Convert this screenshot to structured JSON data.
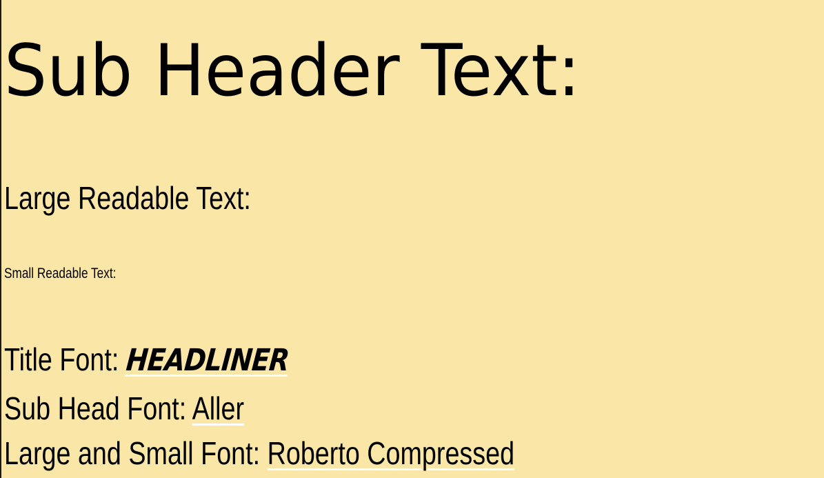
{
  "page": {
    "background": "#fae6a6",
    "text_color": "#000000",
    "link_underline_color": "#ffffff"
  },
  "sub_header": "Sub Header Text:",
  "large_readable": "Large Readable Text:",
  "small_readable": "Small Readable Text:",
  "fonts": {
    "title": {
      "label": "Title Font: ",
      "value": "HEADLINER"
    },
    "sub_head": {
      "label": "Sub Head Font: ",
      "value": "Aller"
    },
    "large_small": {
      "label": "Large and Small Font: ",
      "value": "Roberto Compressed"
    }
  }
}
